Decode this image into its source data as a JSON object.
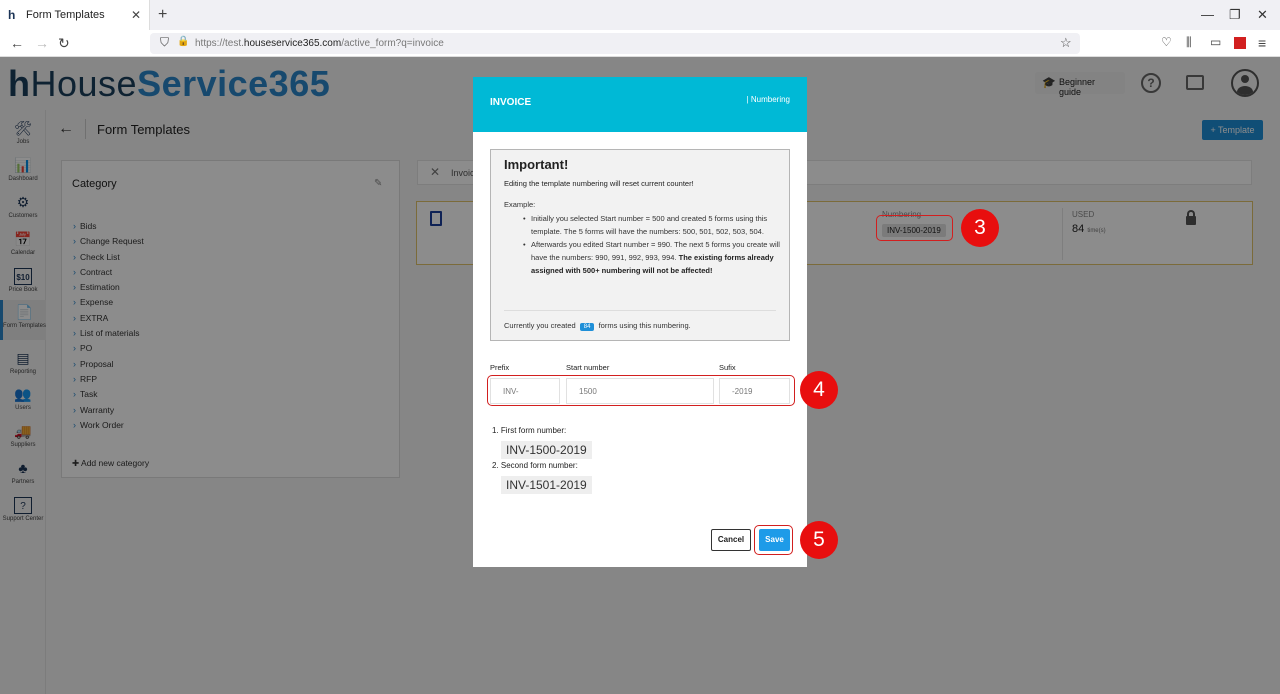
{
  "browser": {
    "tab_title": "Form Templates",
    "url_prefix": "https://test.",
    "url_domain": "houseservice365.com",
    "url_path": "/active_form?q=invoice"
  },
  "app": {
    "logo_h": "h",
    "logo_house": "House",
    "logo_service": "Service365",
    "beginner_guide": "Beginner guide",
    "help": "?",
    "page_title": "Form Templates",
    "template_button": "+ Template"
  },
  "sidebar": {
    "items": [
      {
        "label": "Jobs",
        "icon": "🛠"
      },
      {
        "label": "Dashboard",
        "icon": "📊"
      },
      {
        "label": "Customers",
        "icon": "⚙"
      },
      {
        "label": "Calendar",
        "icon": "📅"
      },
      {
        "label": "Price Book",
        "icon": "$10"
      },
      {
        "label": "Form Templates",
        "icon": "📄"
      },
      {
        "label": "Reporting",
        "icon": "▤"
      },
      {
        "label": "Users",
        "icon": "👥"
      },
      {
        "label": "Suppliers",
        "icon": "🚚"
      },
      {
        "label": "Partners",
        "icon": "♣"
      },
      {
        "label": "Support Center",
        "icon": "?"
      }
    ]
  },
  "category": {
    "title": "Category",
    "items": [
      "Bids",
      "Change Request",
      "Check List",
      "Contract",
      "Estimation",
      "Expense",
      "EXTRA",
      "List of materials",
      "PO",
      "Proposal",
      "RFP",
      "Task",
      "Warranty",
      "Work Order"
    ],
    "add_label": "Add new category"
  },
  "search": {
    "chip": "Invoice"
  },
  "card": {
    "numbering_label": "Numbering",
    "numbering_value": "INV-1500-2019",
    "used_label": "USED",
    "used_value": "84",
    "used_unit": "time(s)"
  },
  "modal": {
    "title": "INVOICE",
    "subtitle": "| Numbering",
    "important_title": "Important!",
    "warning": "Editing the template numbering will reset current counter!",
    "example_label": "Example:",
    "bullet1": "Initially you selected Start number = 500 and created 5 forms using this template. The 5 forms will have the numbers: 500, 501, 502, 503, 504.",
    "bullet2_plain": "Afterwards you edited Start number = 990. The next 5 forms you create will have the numbers: 990, 991, 992, 993, 994.",
    "bullet2_bold": " The existing forms already assigned with 500+ numbering will not be affected!",
    "footer_pre": "Currently you created",
    "footer_count": "84",
    "footer_post": "forms using this numbering.",
    "prefix_label": "Prefix",
    "start_label": "Start number",
    "suffix_label": "Sufix",
    "prefix_value": "INV-",
    "start_value": "1500",
    "suffix_value": "-2019",
    "first_label": "1. First form number:",
    "first_value": "INV-1500-2019",
    "second_label": "2. Second form number:",
    "second_value": "INV-1501-2019",
    "cancel_label": "Cancel",
    "save_label": "Save"
  },
  "annotations": {
    "step3": "3",
    "step4": "4",
    "step5": "5",
    "color": "#e80e0e"
  }
}
